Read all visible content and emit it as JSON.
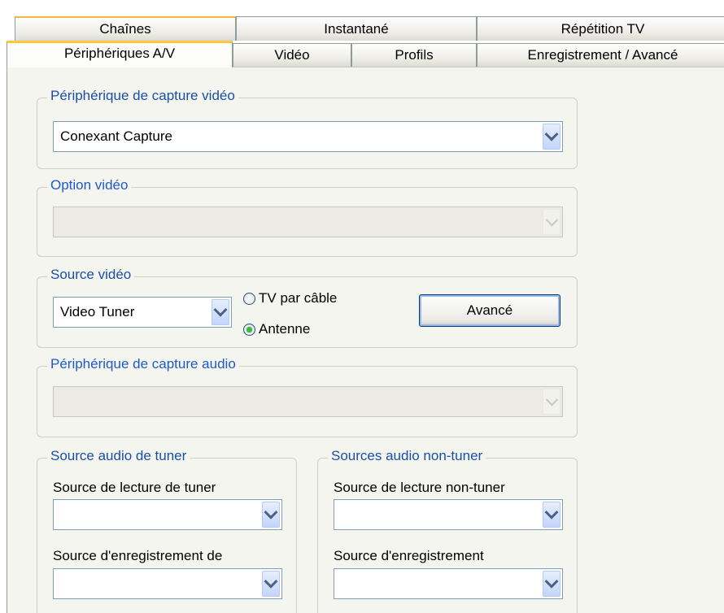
{
  "tabs": {
    "back_row": [
      {
        "label": "Chaînes"
      },
      {
        "label": "Instantané"
      },
      {
        "label": "Répétition TV"
      }
    ],
    "front_row": [
      {
        "label": "Périphériques A/V"
      },
      {
        "label": "Vidéo"
      },
      {
        "label": "Profils"
      },
      {
        "label": "Enregistrement / Avancé"
      }
    ]
  },
  "video_capture": {
    "title": "Périphérique de capture vidéo",
    "value": "Conexant Capture"
  },
  "video_option": {
    "title": "Option vidéo",
    "value": ""
  },
  "video_source": {
    "title": "Source vidéo",
    "value": "Video Tuner",
    "radio_cable": "TV par câble",
    "radio_antenna": "Antenne",
    "selected": "Antenne",
    "advanced_button": "Avancé"
  },
  "audio_capture": {
    "title": "Périphérique de capture audio",
    "value": ""
  },
  "tuner_audio": {
    "title": "Source audio de tuner",
    "playback_label": "Source de lecture de tuner",
    "playback_value": "",
    "recording_label": "Source d'enregistrement de",
    "recording_value": ""
  },
  "nontuner_audio": {
    "title": "Sources audio non-tuner",
    "playback_label": "Source de lecture non-tuner",
    "playback_value": "",
    "recording_label": "Source d'enregistrement",
    "recording_value": ""
  },
  "colors": {
    "group_title": "#1a4fa6",
    "active_tab_accent": "#ffc83c",
    "panel_bg": "#f5f5ef"
  },
  "icons": {
    "dropdown": "chevron-down-icon"
  }
}
